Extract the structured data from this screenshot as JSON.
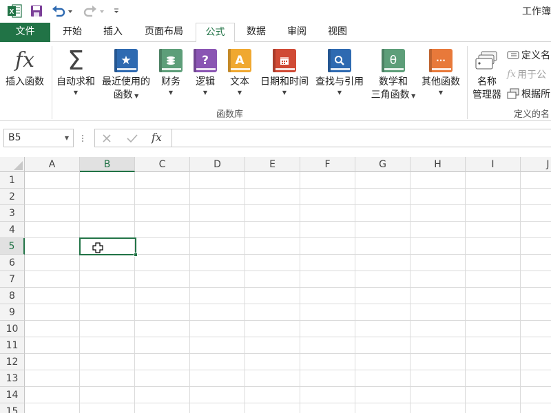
{
  "app": {
    "title": "工作簿",
    "logo_icon": "excel-logo-icon",
    "accent_color": "#217346"
  },
  "qat": {
    "save_icon": "save-icon",
    "undo_icon": "undo-icon",
    "redo_icon": "redo-icon",
    "customize_icon": "customize-qat-icon"
  },
  "tabs": [
    {
      "label": "文件"
    },
    {
      "label": "开始"
    },
    {
      "label": "插入"
    },
    {
      "label": "页面布局"
    },
    {
      "label": "公式"
    },
    {
      "label": "数据"
    },
    {
      "label": "审阅"
    },
    {
      "label": "视图"
    }
  ],
  "active_tab": "公式",
  "ribbon": {
    "insert_function": {
      "label": "插入函数",
      "glyph": "fx"
    },
    "autosum": {
      "label": "自动求和",
      "glyph": "Σ"
    },
    "recent": {
      "line1": "最近使用的",
      "line2": "函数",
      "glyph": "★",
      "color": "#2e6ab1"
    },
    "financial": {
      "label": "财务",
      "color": "#5d9e79"
    },
    "logical": {
      "label": "逻辑",
      "glyph": "?",
      "color": "#8a55b3"
    },
    "text": {
      "label": "文本",
      "glyph": "A",
      "color": "#f0a830"
    },
    "datetime": {
      "label": "日期和时间",
      "color": "#d04a35"
    },
    "lookup": {
      "label": "查找与引用",
      "color": "#2e6ab1"
    },
    "math": {
      "line1": "数学和",
      "line2": "三角函数",
      "glyph": "θ",
      "color": "#5d9e79"
    },
    "more": {
      "label": "其他函数",
      "glyph": "···",
      "color": "#e8793a"
    },
    "group_label": "函数库",
    "name_manager": {
      "line1": "名称",
      "line2": "管理器"
    },
    "define_name": {
      "label": "定义名"
    },
    "use_in_formula": {
      "label": "用于公"
    },
    "create_from_selection": {
      "label": "根据所"
    },
    "defined_names_group": "定义的名"
  },
  "formula_bar": {
    "name_box": "B5",
    "cancel_icon": "cancel-icon",
    "enter_icon": "enter-check-icon",
    "fx_glyph": "fx",
    "value": ""
  },
  "sheet": {
    "columns": [
      "A",
      "B",
      "C",
      "D",
      "E",
      "F",
      "G",
      "H",
      "I",
      "J"
    ],
    "rows": [
      "1",
      "2",
      "3",
      "4",
      "5",
      "6",
      "7",
      "8",
      "9",
      "10",
      "11",
      "12",
      "13",
      "14",
      "15"
    ],
    "active_cell": "B5",
    "pointer_icon": "cell-select-cursor-icon"
  }
}
